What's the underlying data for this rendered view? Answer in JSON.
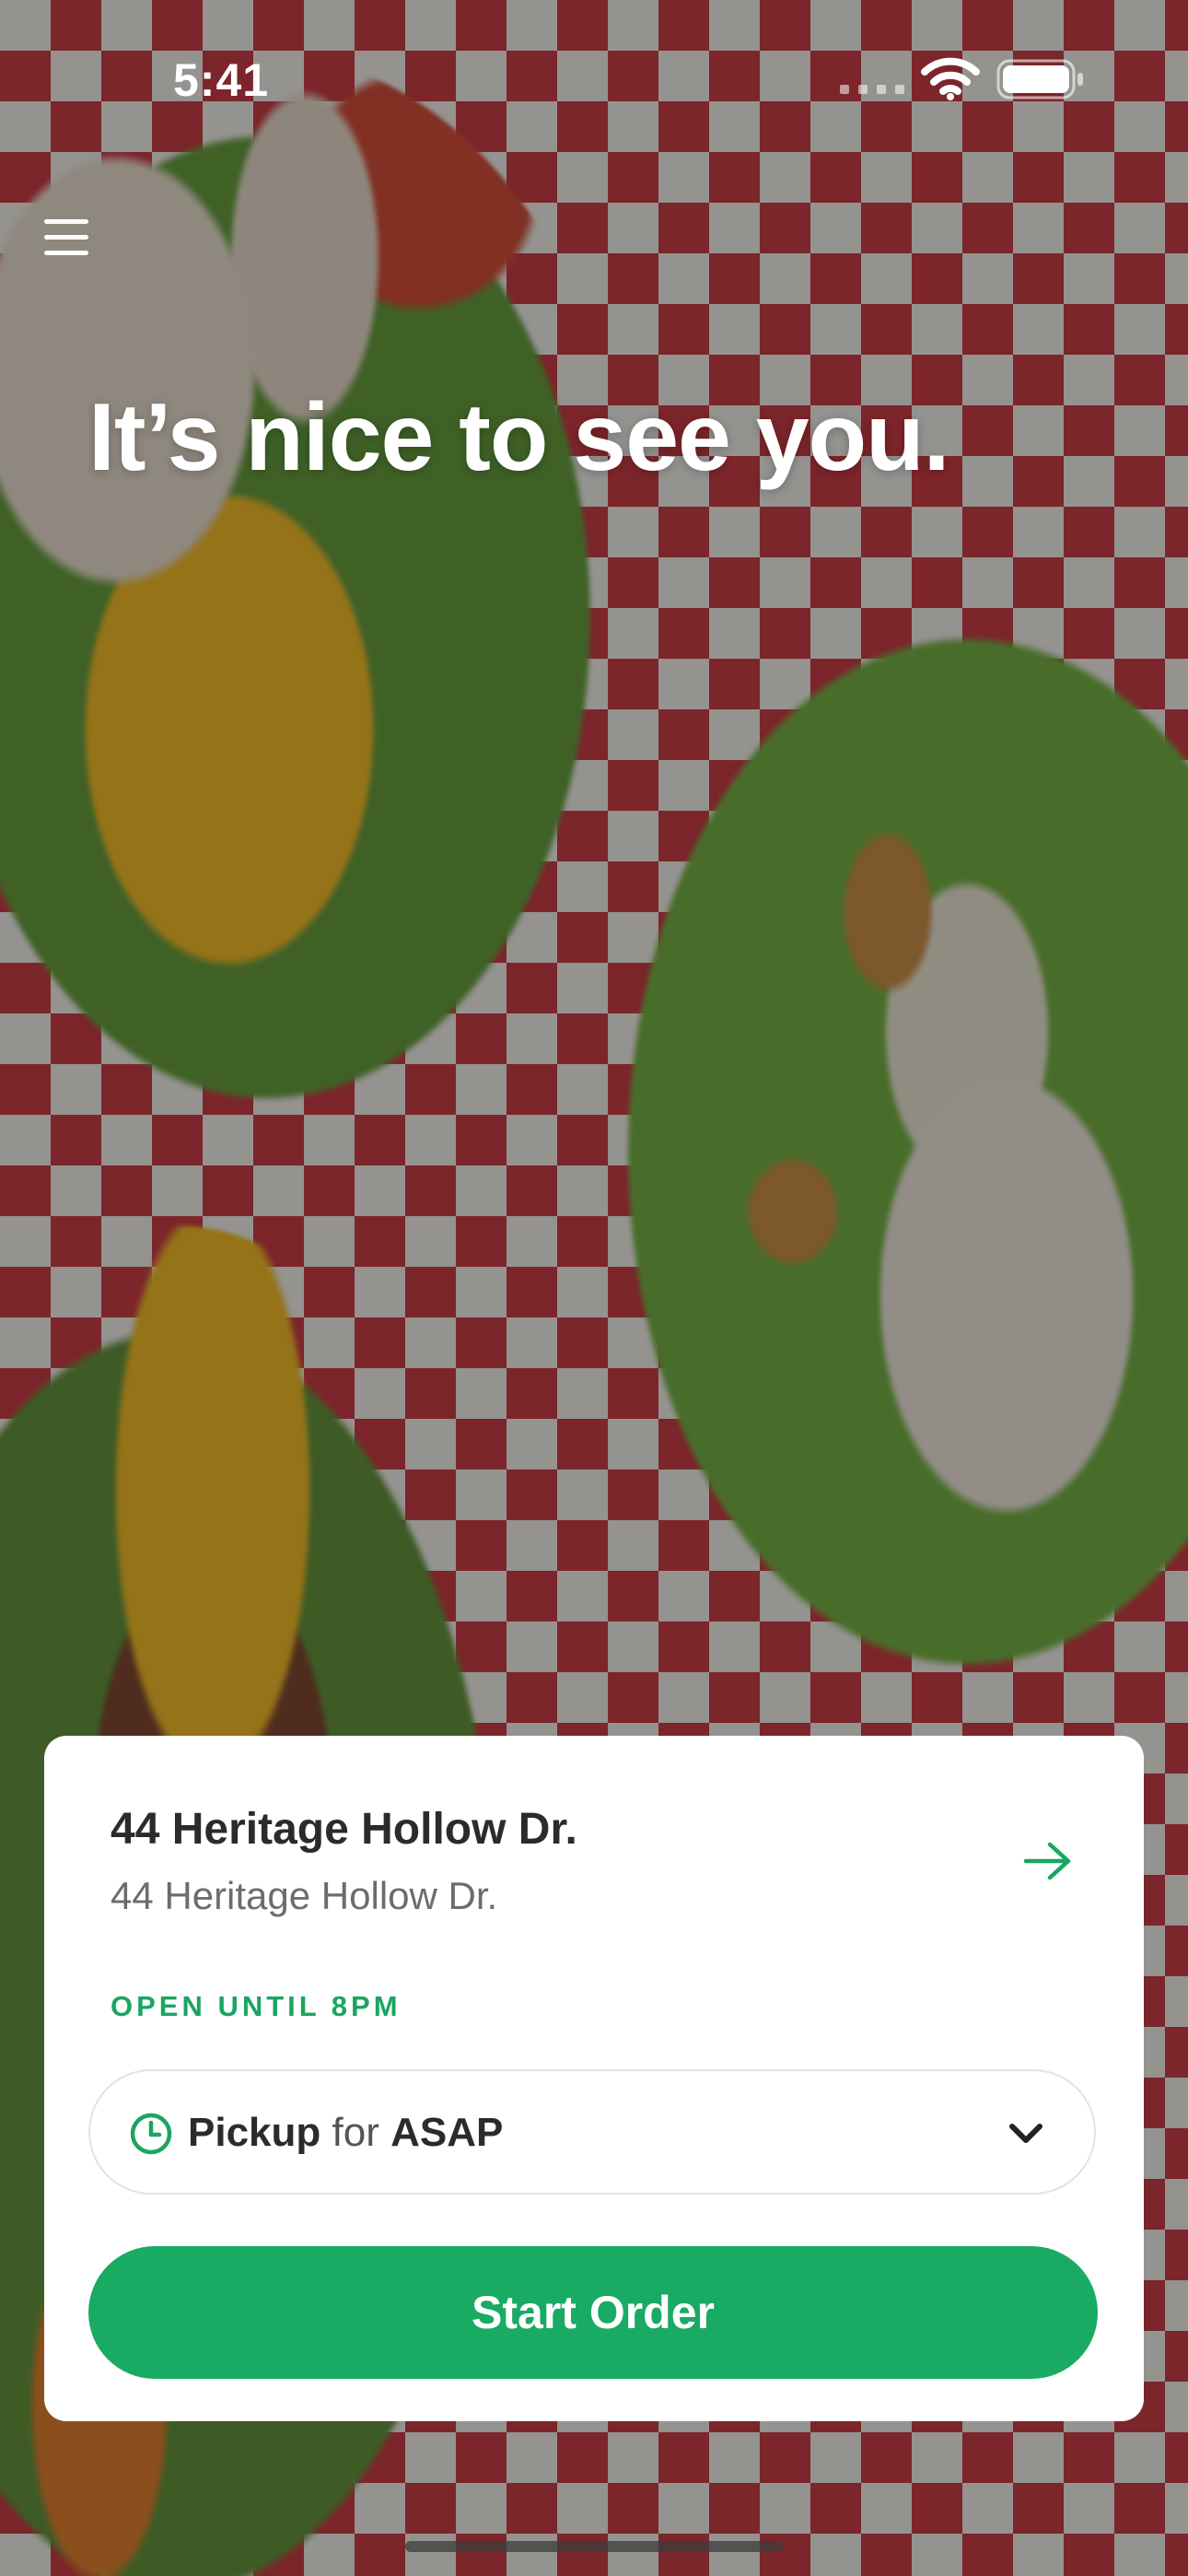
{
  "status_bar": {
    "time": "5:41"
  },
  "greeting": "It’s nice to see you.",
  "location": {
    "name": "44 Heritage Hollow Dr.",
    "address": "44 Heritage Hollow Dr.",
    "hours_status": "OPEN UNTIL 8PM"
  },
  "order_type": {
    "mode": "Pickup",
    "connector": "for",
    "time": "ASAP"
  },
  "start_button_label": "Start Order",
  "colors": {
    "accent_green": "#19aa63",
    "text_dark": "#2b2b2b",
    "text_muted": "#6c6c6c"
  },
  "icons": {
    "menu": "hamburger-menu-icon",
    "arrow": "arrow-right-icon",
    "clock": "clock-icon",
    "chevron": "chevron-down-icon",
    "wifi": "wifi-icon",
    "battery": "battery-icon",
    "signal": "signal-icon"
  }
}
